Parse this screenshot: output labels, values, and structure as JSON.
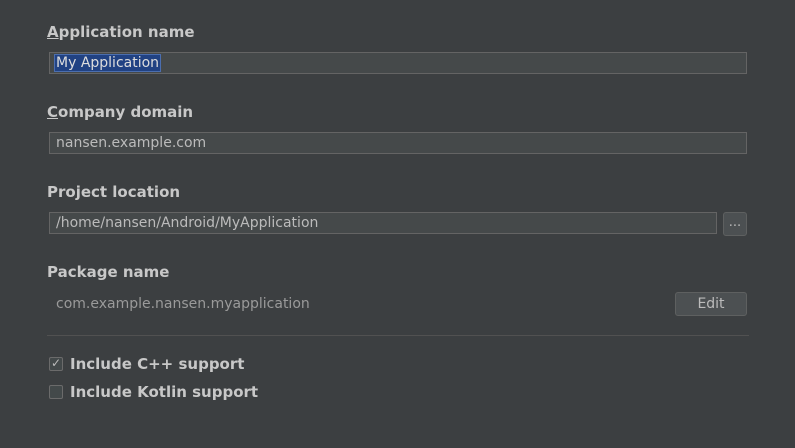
{
  "app_name": {
    "label_mnemonic": "A",
    "label_rest": "pplication name",
    "value": "My Application"
  },
  "company_domain": {
    "label_mnemonic": "C",
    "label_rest": "ompany domain",
    "value": "nansen.example.com"
  },
  "project_location": {
    "label": "Project location",
    "value": "/home/nansen/Android/MyApplication",
    "browse_label": "..."
  },
  "package_name": {
    "label": "Package name",
    "value": "com.example.nansen.myapplication",
    "edit_label": "Edit"
  },
  "options": {
    "cpp": {
      "label": "Include C++ support",
      "checked": true,
      "check_glyph": "✓"
    },
    "kotlin": {
      "label": "Include Kotlin support",
      "checked": false
    }
  }
}
